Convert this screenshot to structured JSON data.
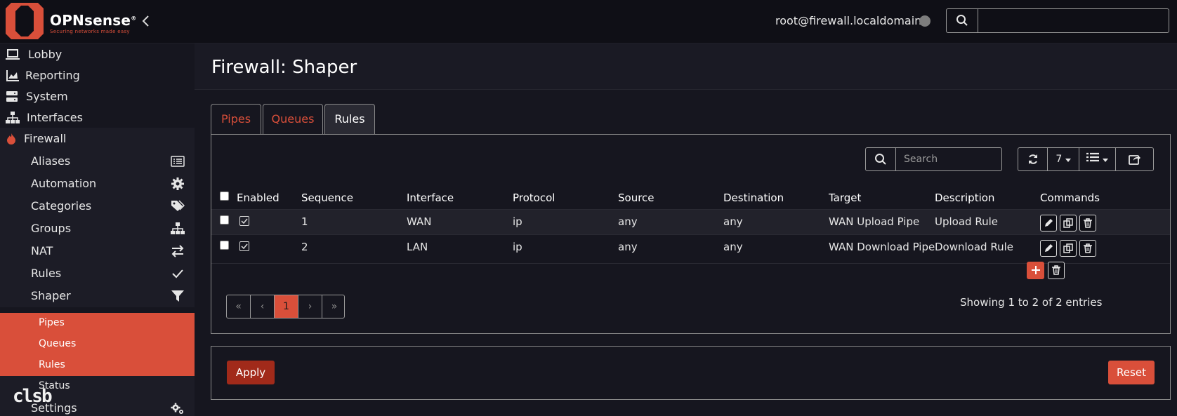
{
  "topbar": {
    "brand": "OPNsense",
    "brand_mark": "®",
    "tagline": "Securing networks made easy",
    "user": "root@firewall.localdomain",
    "search_value": ""
  },
  "sidebar": {
    "top_items": [
      {
        "label": "Lobby",
        "icon": "laptop-icon"
      },
      {
        "label": "Reporting",
        "icon": "chart-icon"
      },
      {
        "label": "System",
        "icon": "server-icon"
      },
      {
        "label": "Interfaces",
        "icon": "sitemap-icon"
      },
      {
        "label": "Firewall",
        "icon": "fire-icon"
      }
    ],
    "firewall_items": [
      {
        "label": "Aliases",
        "icon": "list-icon"
      },
      {
        "label": "Automation",
        "icon": "gear-icon"
      },
      {
        "label": "Categories",
        "icon": "tags-icon"
      },
      {
        "label": "Groups",
        "icon": "sitemap-icon"
      },
      {
        "label": "NAT",
        "icon": "exchange-icon"
      },
      {
        "label": "Rules",
        "icon": "check-icon"
      },
      {
        "label": "Shaper",
        "icon": "filter-icon"
      }
    ],
    "shaper_items": [
      {
        "label": "Pipes",
        "active": true
      },
      {
        "label": "Queues",
        "active": true
      },
      {
        "label": "Rules",
        "active": true
      },
      {
        "label": "Status",
        "active": false
      }
    ],
    "settings": {
      "label": "Settings",
      "icon": "gears-icon"
    },
    "watermark": "clsb"
  },
  "page": {
    "title": "Firewall: Shaper"
  },
  "tabs": [
    {
      "label": "Pipes",
      "active": false
    },
    {
      "label": "Queues",
      "active": false
    },
    {
      "label": "Rules",
      "active": true
    }
  ],
  "table": {
    "search_placeholder": "Search",
    "page_size": "7",
    "columns": [
      "Enabled",
      "Sequence",
      "Interface",
      "Protocol",
      "Source",
      "Destination",
      "Target",
      "Description",
      "Commands"
    ],
    "rows": [
      {
        "sequence": "1",
        "interface": "WAN",
        "protocol": "ip",
        "source": "any",
        "destination": "any",
        "target": "WAN Upload Pipe",
        "description": "Upload Rule"
      },
      {
        "sequence": "2",
        "interface": "LAN",
        "protocol": "ip",
        "source": "any",
        "destination": "any",
        "target": "WAN Download Pipe",
        "description": "Download Rule"
      }
    ],
    "pager": [
      "«",
      "‹",
      "1",
      "›",
      "»"
    ],
    "showing": "Showing 1 to 2 of 2 entries"
  },
  "footer": {
    "apply": "Apply",
    "reset": "Reset"
  },
  "colors": {
    "accent": "#d94f3a",
    "background": "#16161f"
  }
}
